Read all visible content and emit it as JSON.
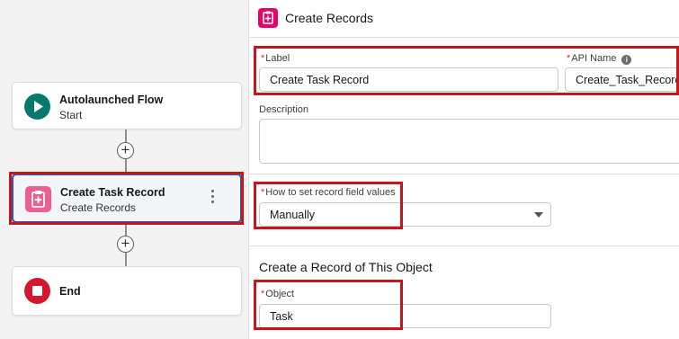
{
  "flow": {
    "start_node": {
      "title": "Autolaunched Flow",
      "subtitle": "Start"
    },
    "create_node": {
      "title": "Create Task Record",
      "subtitle": "Create Records"
    },
    "end_node": {
      "title": "End"
    },
    "add_symbol": "+"
  },
  "panel": {
    "title": "Create Records",
    "label_field": {
      "label": "Label",
      "value": "Create Task Record"
    },
    "api_name_field": {
      "label": "API Name",
      "value": "Create_Task_Record",
      "info_glyph": "i"
    },
    "description_field": {
      "label": "Description",
      "value": ""
    },
    "record_values_field": {
      "label": "How to set record field values",
      "value": "Manually"
    },
    "section_title": "Create a Record of This Object",
    "object_field": {
      "label": "Object",
      "value": "Task"
    },
    "required_marker": "*"
  },
  "colors": {
    "start_icon": "#047a6f",
    "create_icon": "#ee5f91",
    "end_icon": "#d5162e",
    "highlight_box": "#c4161c",
    "selection_border": "#1b5fc2"
  },
  "icons": {
    "start": "play-icon",
    "create": "create-record-icon",
    "end": "stop-icon",
    "info": "info-icon",
    "dropdown": "chevron-down-icon"
  }
}
